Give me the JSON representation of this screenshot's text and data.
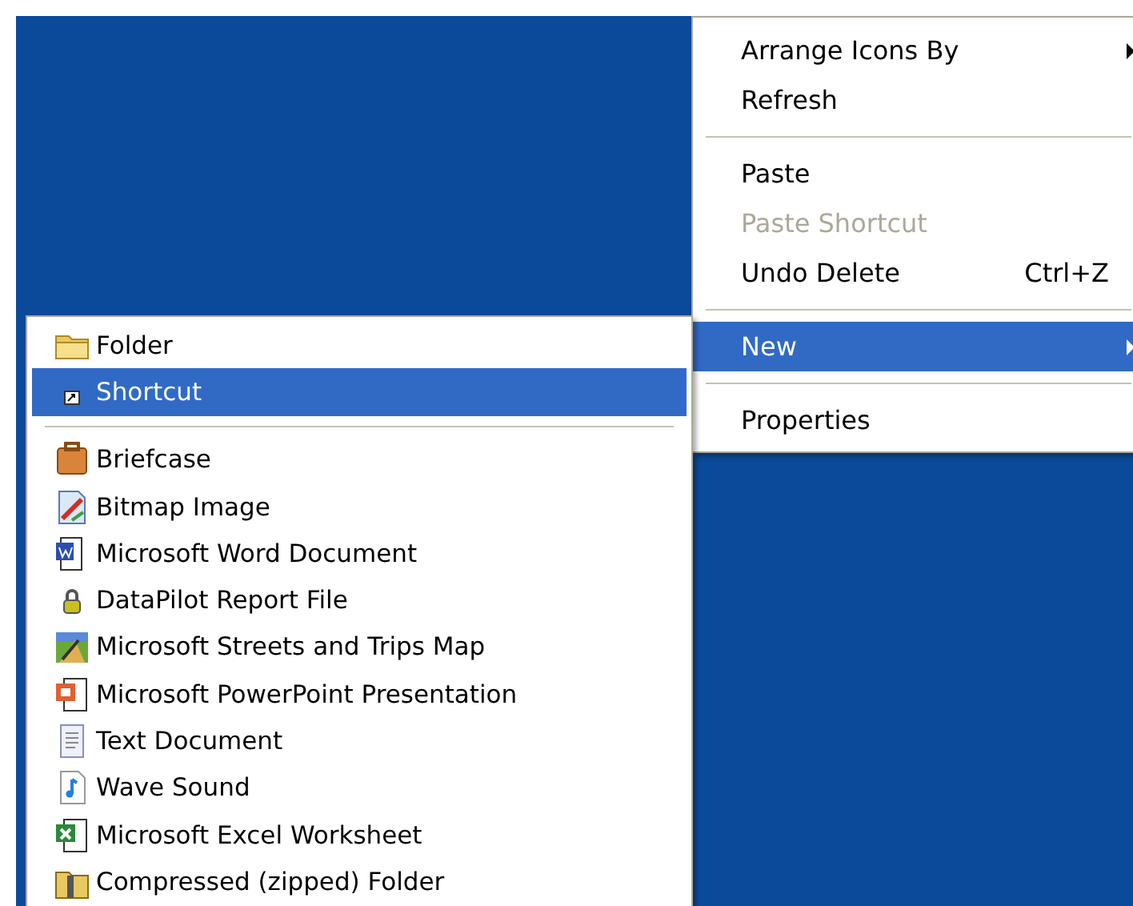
{
  "context_menu": {
    "items": [
      {
        "kind": "item",
        "label": "Arrange Icons By",
        "submenu": true,
        "disabled": false,
        "selected": false
      },
      {
        "kind": "item",
        "label": "Refresh",
        "submenu": false,
        "disabled": false,
        "selected": false
      },
      {
        "kind": "separator"
      },
      {
        "kind": "item",
        "label": "Paste",
        "submenu": false,
        "disabled": false,
        "selected": false
      },
      {
        "kind": "item",
        "label": "Paste Shortcut",
        "submenu": false,
        "disabled": true,
        "selected": false
      },
      {
        "kind": "item",
        "label": "Undo Delete",
        "shortcut": "Ctrl+Z",
        "submenu": false,
        "disabled": false,
        "selected": false
      },
      {
        "kind": "separator"
      },
      {
        "kind": "item",
        "label": "New",
        "submenu": true,
        "disabled": false,
        "selected": true
      },
      {
        "kind": "separator"
      },
      {
        "kind": "item",
        "label": "Properties",
        "submenu": false,
        "disabled": false,
        "selected": false
      }
    ]
  },
  "new_submenu": {
    "items": [
      {
        "kind": "item",
        "label": "Folder",
        "selected": false
      },
      {
        "kind": "item",
        "label": "Shortcut",
        "selected": true
      },
      {
        "kind": "separator"
      },
      {
        "kind": "item",
        "label": "Briefcase",
        "selected": false
      },
      {
        "kind": "item",
        "label": "Bitmap Image",
        "selected": false
      },
      {
        "kind": "item",
        "label": "Microsoft Word Document",
        "selected": false
      },
      {
        "kind": "item",
        "label": "DataPilot Report File",
        "selected": false
      },
      {
        "kind": "item",
        "label": "Microsoft Streets and Trips Map",
        "selected": false
      },
      {
        "kind": "item",
        "label": "Microsoft PowerPoint Presentation",
        "selected": false
      },
      {
        "kind": "item",
        "label": "Text Document",
        "selected": false
      },
      {
        "kind": "item",
        "label": "Wave Sound",
        "selected": false
      },
      {
        "kind": "item",
        "label": "Microsoft Excel Worksheet",
        "selected": false
      },
      {
        "kind": "item",
        "label": "Compressed (zipped) Folder",
        "selected": false
      }
    ]
  }
}
